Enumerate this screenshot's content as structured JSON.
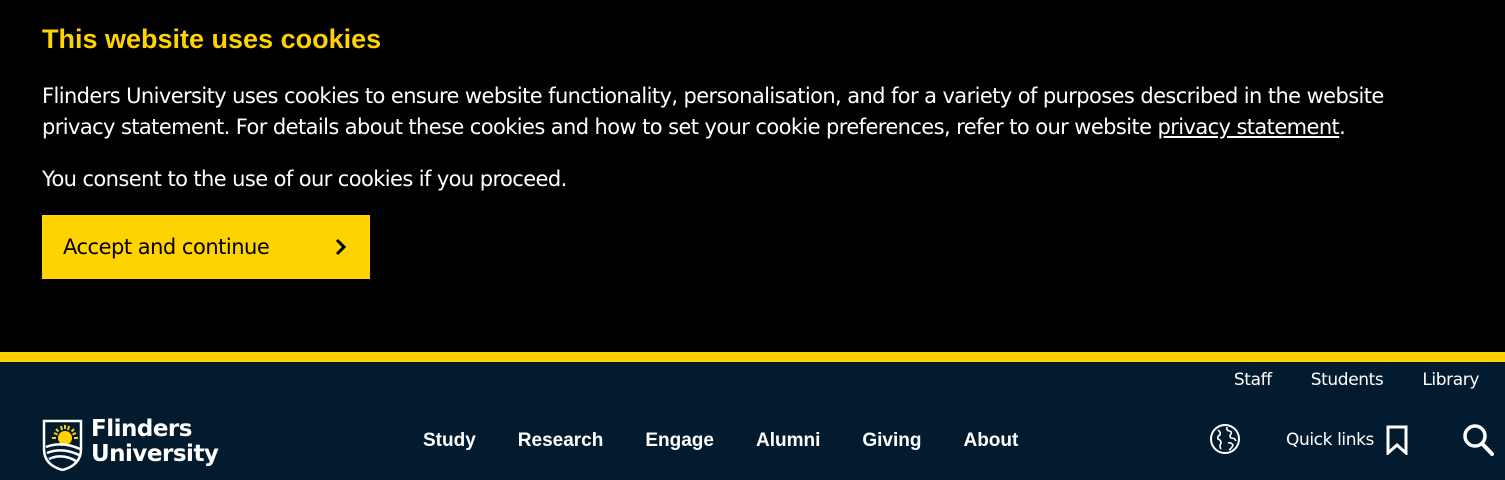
{
  "cookie_banner": {
    "title": "This website uses cookies",
    "text_before_link": "Flinders University uses cookies to ensure website functionality, personalisation, and for a variety of purposes described in the website privacy statement. For details about these cookies and how to set your cookie preferences, refer to our website ",
    "link_text": "privacy statement",
    "text_after_link": ".",
    "consent_text": "You consent to the use of our cookies if you proceed.",
    "accept_label": "Accept and continue",
    "accept_icon": "chevron-right-icon"
  },
  "colors": {
    "accent_yellow": "#ffd300",
    "banner_bg": "#000000",
    "header_bg": "#031b2e",
    "text": "#ffffff"
  },
  "header": {
    "utility_nav": [
      "Staff",
      "Students",
      "Library"
    ],
    "logo": {
      "line1": "Flinders",
      "line2": "University"
    },
    "main_nav": [
      "Study",
      "Research",
      "Engage",
      "Alumni",
      "Giving",
      "About"
    ],
    "globe_icon": "globe-icon",
    "quick_links_label": "Quick links",
    "quick_links_icon": "bookmark-icon",
    "search_icon": "search-icon"
  }
}
